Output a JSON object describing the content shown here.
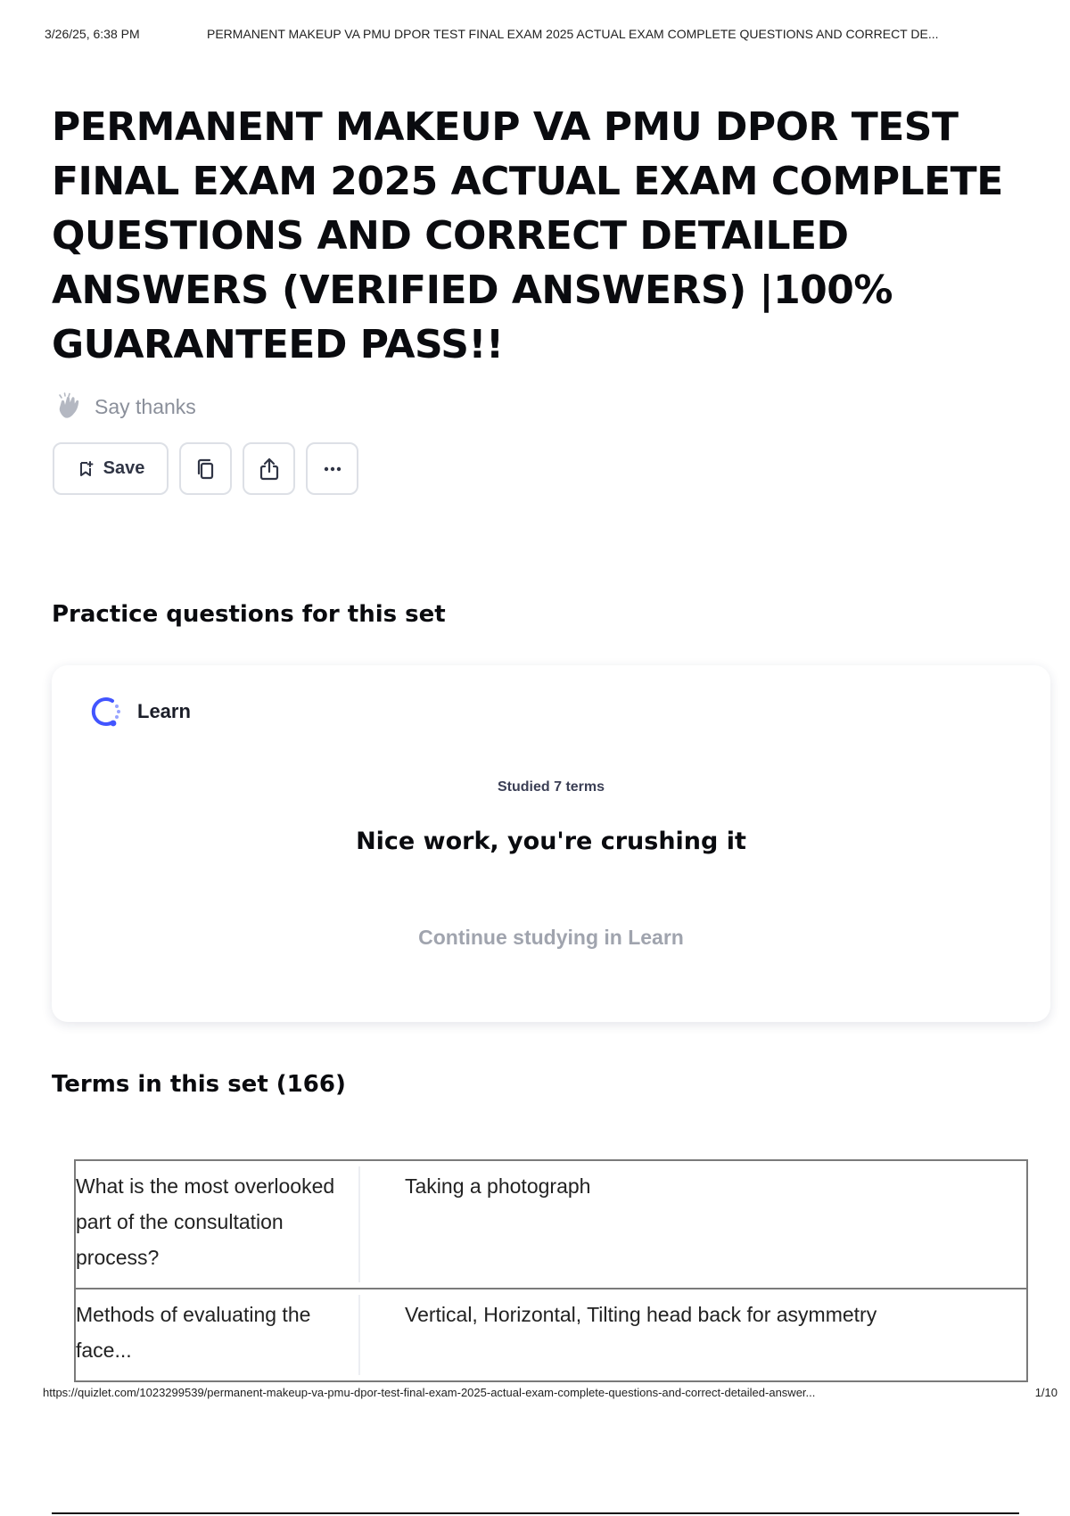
{
  "print_header": {
    "datetime": "3/26/25, 6:38 PM",
    "title": "PERMANENT MAKEUP VA PMU DPOR TEST FINAL EXAM 2025 ACTUAL EXAM COMPLETE QUESTIONS AND CORRECT DE..."
  },
  "title": "PERMANENT MAKEUP VA PMU DPOR TEST FINAL EXAM 2025 ACTUAL EXAM COMPLETE QUESTIONS AND CORRECT DETAILED ANSWERS (VERIFIED ANSWERS) |100% GUARANTEED PASS!!",
  "say_thanks": {
    "label": "Say thanks",
    "icon": "clapping-hands-icon"
  },
  "actions": {
    "save_label": "Save",
    "save_icon": "bookmark-icon",
    "copy_icon": "copy-icon",
    "share_icon": "share-icon",
    "more_icon": "more-icon"
  },
  "practice": {
    "heading": "Practice questions for this set",
    "learn_label": "Learn",
    "learn_icon": "learn-progress-icon",
    "studied": "Studied 7 terms",
    "message": "Nice work, you're crushing it",
    "continue": "Continue studying in Learn"
  },
  "terms": {
    "heading": "Terms in this set (166)",
    "rows": [
      {
        "term": "What is the most overlooked part of the consultation process?",
        "definition": "Taking a photograph"
      },
      {
        "term": "Methods of evaluating the face...",
        "definition": "Vertical, Horizontal, Tilting head back for asymmetry"
      }
    ]
  },
  "print_footer": {
    "url": "https://quizlet.com/1023299539/permanent-makeup-va-pmu-dpor-test-final-exam-2025-actual-exam-complete-questions-and-correct-detailed-answer...",
    "page": "1/10"
  },
  "colors": {
    "accent": "#4255ff",
    "text": "#0a0b0f",
    "muted": "#a0a4ae",
    "border": "#dde0e6"
  }
}
